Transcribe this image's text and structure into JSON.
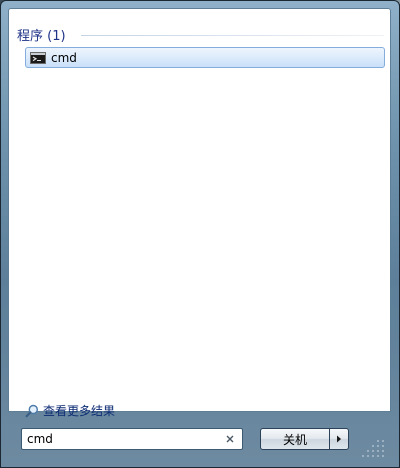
{
  "results": {
    "group_title": "程序 (1)",
    "items": [
      {
        "label": "cmd",
        "icon": "command-prompt-icon"
      }
    ]
  },
  "more_results": {
    "label": "查看更多结果",
    "icon": "search-icon"
  },
  "search": {
    "value": "cmd",
    "clear_icon": "clear-icon"
  },
  "power": {
    "shutdown_label": "关机",
    "menu_icon": "arrow-right-icon"
  },
  "colors": {
    "group_title": "#1e3287",
    "selected_item_border": "#84acdd",
    "frame": "#6f93ad"
  }
}
